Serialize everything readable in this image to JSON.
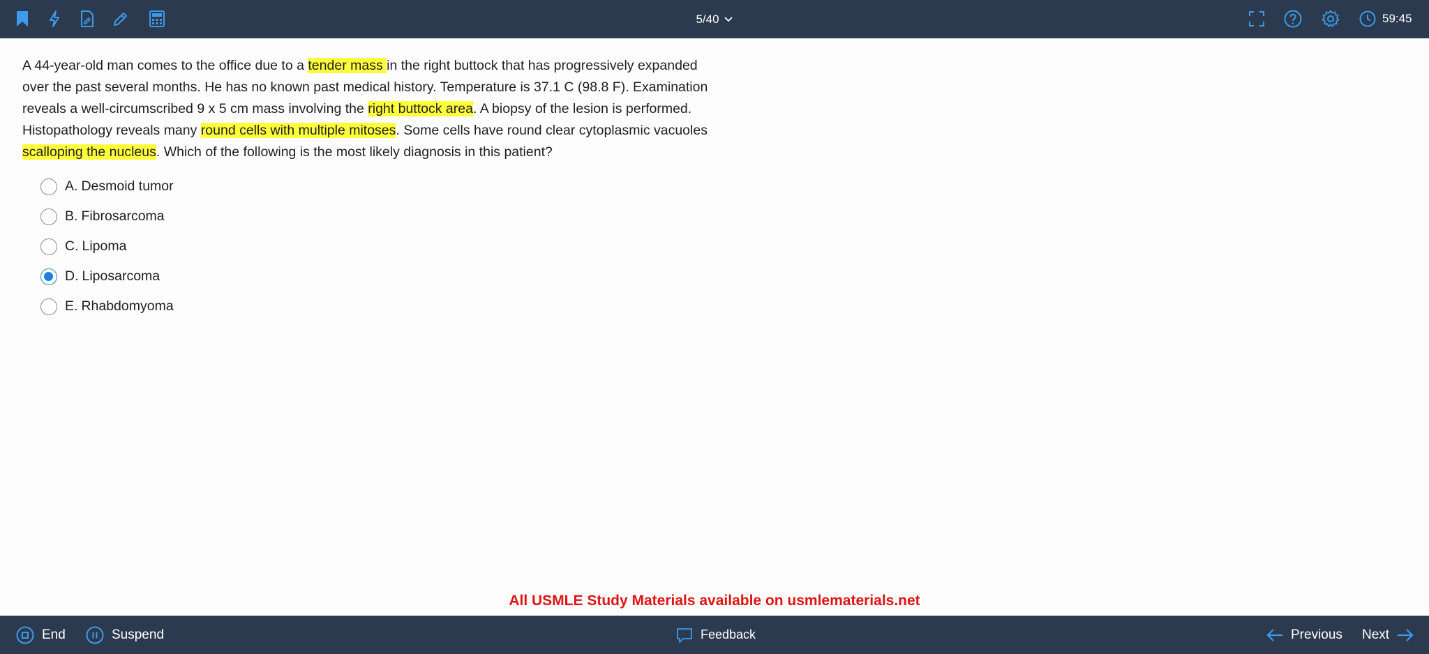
{
  "header": {
    "question_counter": "5/40",
    "timer": "59:45",
    "icons": [
      "bookmark-icon",
      "lightning-icon",
      "notes-icon",
      "pen-icon",
      "calculator-icon",
      "fullscreen-icon",
      "help-icon",
      "settings-icon",
      "clock-icon"
    ]
  },
  "question": {
    "segments": [
      {
        "text": "A 44-year-old man comes to the office due to a ",
        "hl": false
      },
      {
        "text": "tender mass ",
        "hl": true
      },
      {
        "text": "in the right buttock that has progressively expanded over the past several months.  He has no known past medical history.  Temperature is 37.1 C (98.8 F).  Examination reveals a well-circumscribed 9 x 5 cm mass involving the ",
        "hl": false
      },
      {
        "text": "right buttock area",
        "hl": true
      },
      {
        "text": ".  A biopsy of the lesion is performed.  Histopathology reveals many ",
        "hl": false
      },
      {
        "text": "round cells with multiple mitoses",
        "hl": true
      },
      {
        "text": ".  Some cells have round clear cytoplasmic vacuoles ",
        "hl": false
      },
      {
        "text": "scalloping the nucleus",
        "hl": true
      },
      {
        "text": ".  Which of the following is the most likely diagnosis in this patient?",
        "hl": false
      }
    ]
  },
  "options": [
    {
      "letter": "A.",
      "text": "Desmoid tumor",
      "selected": false
    },
    {
      "letter": "B.",
      "text": "Fibrosarcoma",
      "selected": false
    },
    {
      "letter": "C.",
      "text": "Lipoma",
      "selected": false
    },
    {
      "letter": "D.",
      "text": "Liposarcoma",
      "selected": true
    },
    {
      "letter": "E.",
      "text": "Rhabdomyoma",
      "selected": false
    }
  ],
  "watermark": "All USMLE Study Materials available on usmlematerials.net",
  "footer": {
    "end_label": "End",
    "suspend_label": "Suspend",
    "feedback_label": "Feedback",
    "previous_label": "Previous",
    "next_label": "Next"
  },
  "colors": {
    "bar_bg": "#2b3a4f",
    "accent": "#3d9be9",
    "highlight": "#ffff3b",
    "watermark": "#e01414"
  }
}
